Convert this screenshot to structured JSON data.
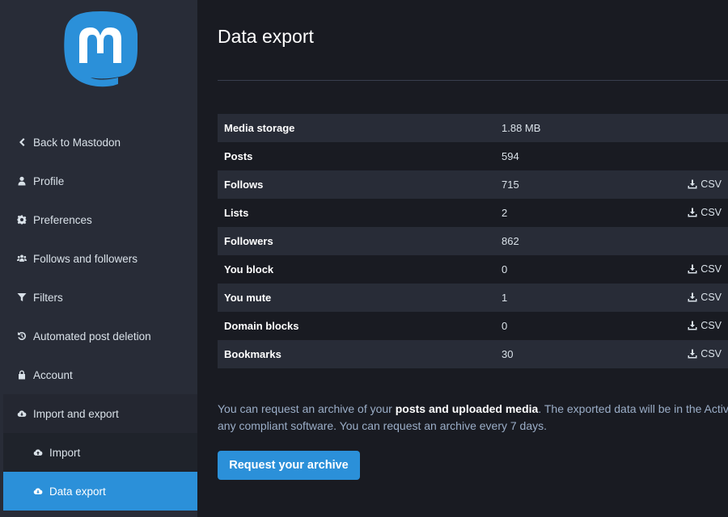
{
  "sidebar": {
    "items": [
      {
        "label": "Back to Mastodon",
        "icon": "chevron-left-icon"
      },
      {
        "label": "Profile",
        "icon": "user-icon"
      },
      {
        "label": "Preferences",
        "icon": "gear-icon"
      },
      {
        "label": "Follows and followers",
        "icon": "users-icon"
      },
      {
        "label": "Filters",
        "icon": "filter-icon"
      },
      {
        "label": "Automated post deletion",
        "icon": "history-icon"
      },
      {
        "label": "Account",
        "icon": "lock-icon"
      },
      {
        "label": "Import and export",
        "icon": "cloud-download-icon"
      },
      {
        "label": "Import",
        "icon": "cloud-upload-icon"
      },
      {
        "label": "Data export",
        "icon": "cloud-download-icon"
      }
    ]
  },
  "main": {
    "title": "Data export",
    "rows": [
      {
        "label": "Media storage",
        "value": "1.88 MB",
        "csv": ""
      },
      {
        "label": "Posts",
        "value": "594",
        "csv": ""
      },
      {
        "label": "Follows",
        "value": "715",
        "csv": "CSV"
      },
      {
        "label": "Lists",
        "value": "2",
        "csv": "CSV"
      },
      {
        "label": "Followers",
        "value": "862",
        "csv": ""
      },
      {
        "label": "You block",
        "value": "0",
        "csv": "CSV"
      },
      {
        "label": "You mute",
        "value": "1",
        "csv": "CSV"
      },
      {
        "label": "Domain blocks",
        "value": "0",
        "csv": "CSV"
      },
      {
        "label": "Bookmarks",
        "value": "30",
        "csv": "CSV"
      }
    ],
    "hint_pre": "You can request an archive of your ",
    "hint_bold": "posts and uploaded media",
    "hint_post": ". The exported data will be in the ActivityPub format, readable by",
    "hint_line2": "any compliant software. You can request an archive every 7 days.",
    "button_label": "Request your archive"
  },
  "colors": {
    "accent": "#2b90d9",
    "sidebar": "#282c37",
    "background": "#191b22"
  }
}
